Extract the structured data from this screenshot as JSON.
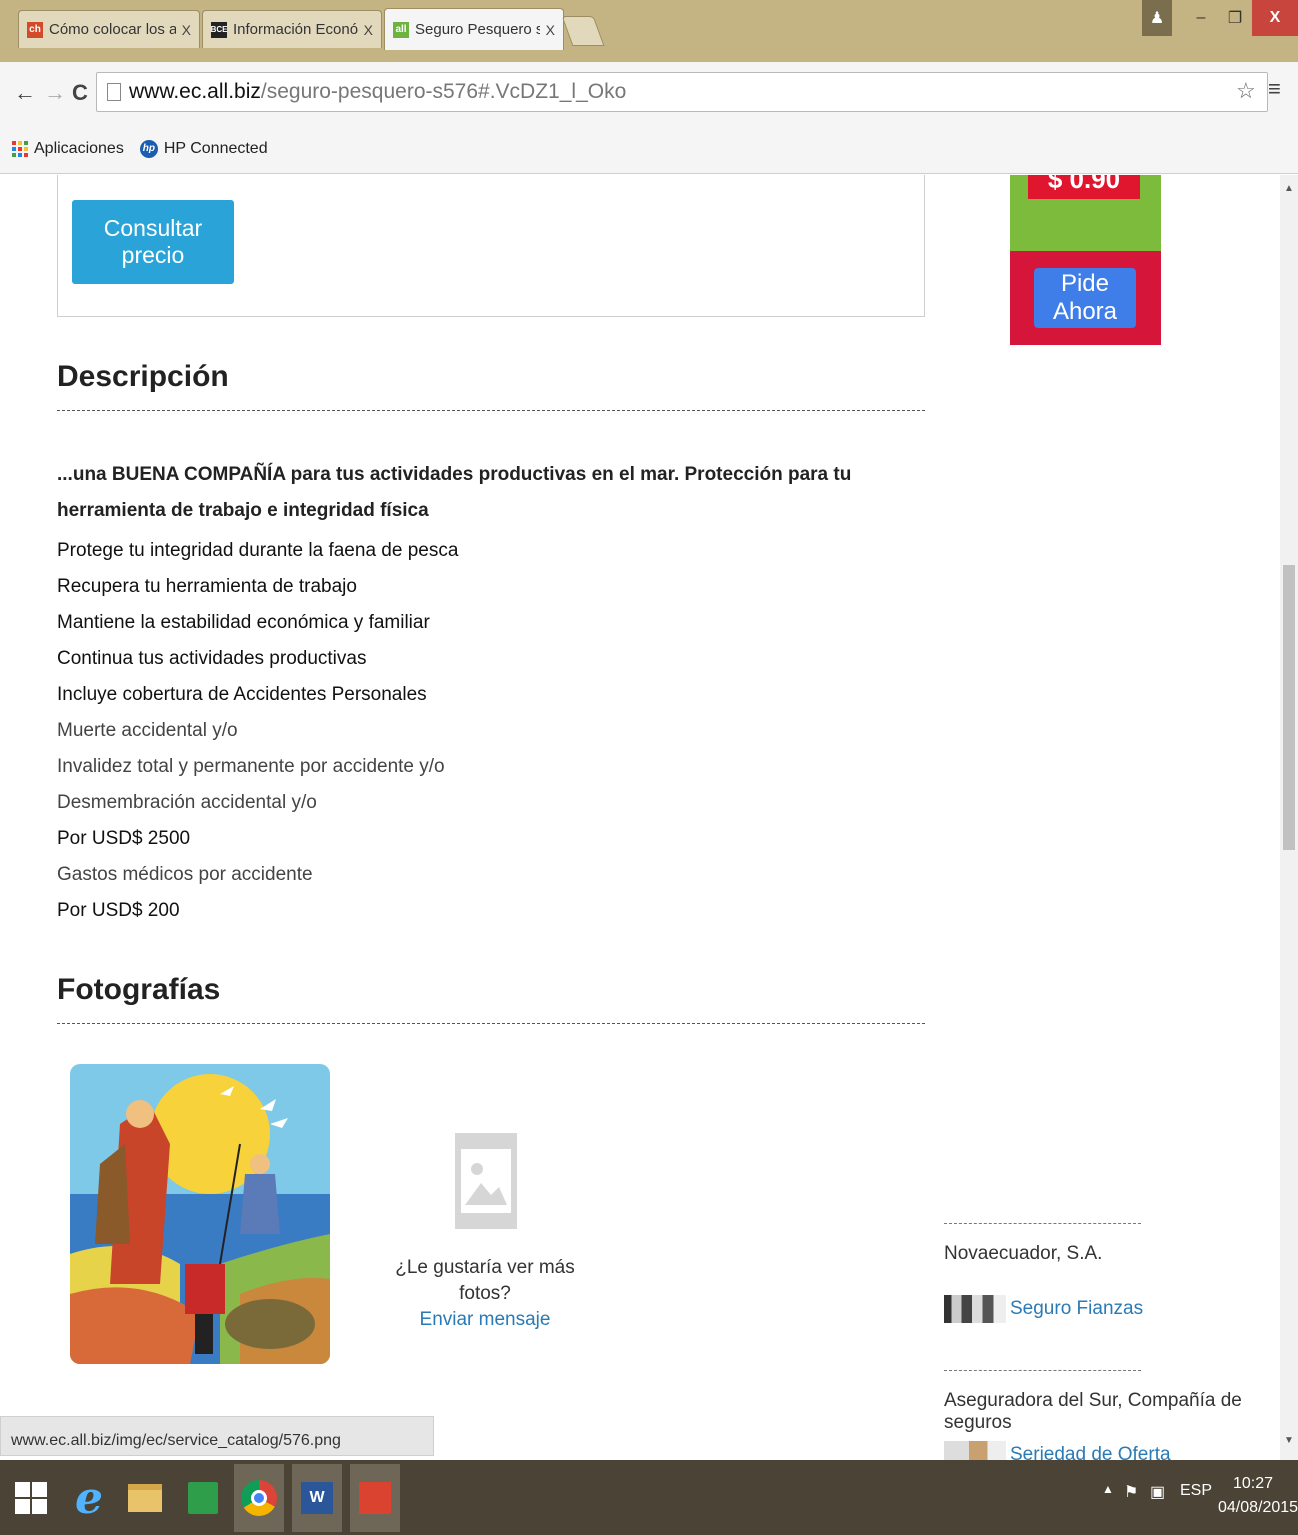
{
  "browser": {
    "tabs": [
      {
        "title": "Cómo colocar los anexos",
        "close": "X",
        "favicon": "ch",
        "favicon_color": "#d24a2a"
      },
      {
        "title": "Información Económica",
        "close": "X",
        "favicon": "BCE",
        "favicon_color": "#222222"
      },
      {
        "title": "Seguro Pesquero solicitar",
        "close": "X",
        "favicon": "all",
        "favicon_color": "#6db33f"
      }
    ],
    "url_host": "www.ec.all.biz",
    "url_path": "/seguro-pesquero-s576#.VcDZ1_l_Oko",
    "bookmarks": [
      {
        "label": "Aplicaciones"
      },
      {
        "label": "HP Connected"
      }
    ],
    "window_close": "X"
  },
  "page": {
    "consult_button": "Consultar precio",
    "ad": {
      "price": "$ 0.90",
      "button": "Pide Ahora"
    },
    "description": {
      "title": "Descripción",
      "lead": "...una BUENA COMPAÑÍA para tus actividades productivas en el mar. Protección para tu herramienta de trabajo e integridad física",
      "items": [
        "Protege tu integridad durante la faena de pesca",
        "Recupera tu herramienta de trabajo",
        "Mantiene la estabilidad económica y familiar",
        "Continua tus actividades productivas",
        "Incluye cobertura de Accidentes Personales",
        "Muerte accidental y/o",
        "Invalidez total y permanente por accidente y/o",
        "Desmembración accidental y/o",
        "Por USD$ 2500",
        "Gastos médicos por accidente",
        "Por USD$ 200"
      ]
    },
    "photos": {
      "title": "Fotografías",
      "more_question": "¿Le gustaría ver más fotos?",
      "more_link": "Enviar mensaje"
    },
    "sidebar": {
      "companies": [
        {
          "name": "Novaecuador, S.A.",
          "link": "Seguro Fianzas"
        },
        {
          "name": "Aseguradora del Sur, Compañía de seguros",
          "link": "Seriedad de Oferta"
        }
      ]
    }
  },
  "status_url": "www.ec.all.biz/img/ec/service_catalog/576.png",
  "taskbar": {
    "language": "ESP",
    "time": "10:27",
    "date": "04/08/2015"
  },
  "colors": {
    "accent_blue": "#2aa4d8",
    "ad_red": "#d5163a",
    "ad_green": "#7dbb3c",
    "link": "#2a7ab5"
  }
}
